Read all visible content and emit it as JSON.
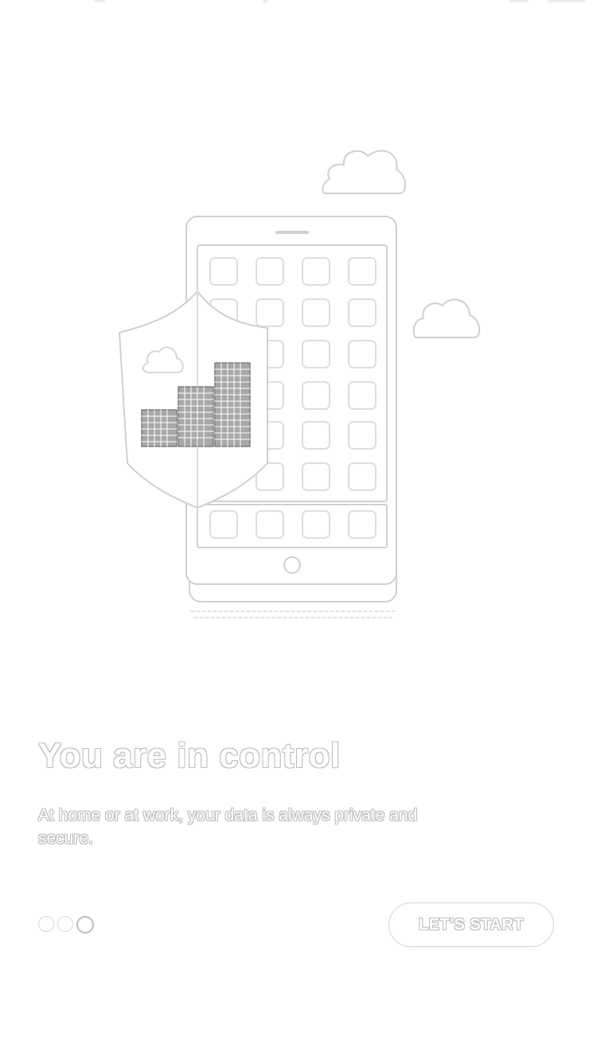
{
  "onboarding": {
    "title": "You are in control",
    "subtitle": "At home or at work, your data is always private and secure.",
    "pager": {
      "total_pages": 3,
      "current_page": 3
    },
    "cta_label": "LET'S START"
  },
  "illustration": {
    "icons": [
      "cloud-icon",
      "phone-icon",
      "shield-icon",
      "buildings-icon"
    ]
  },
  "colors": {
    "background": "#ffffff",
    "outline": "#d0d0d0",
    "text_outline": "#bdbdbd",
    "buildings": "#8a8a8a"
  }
}
